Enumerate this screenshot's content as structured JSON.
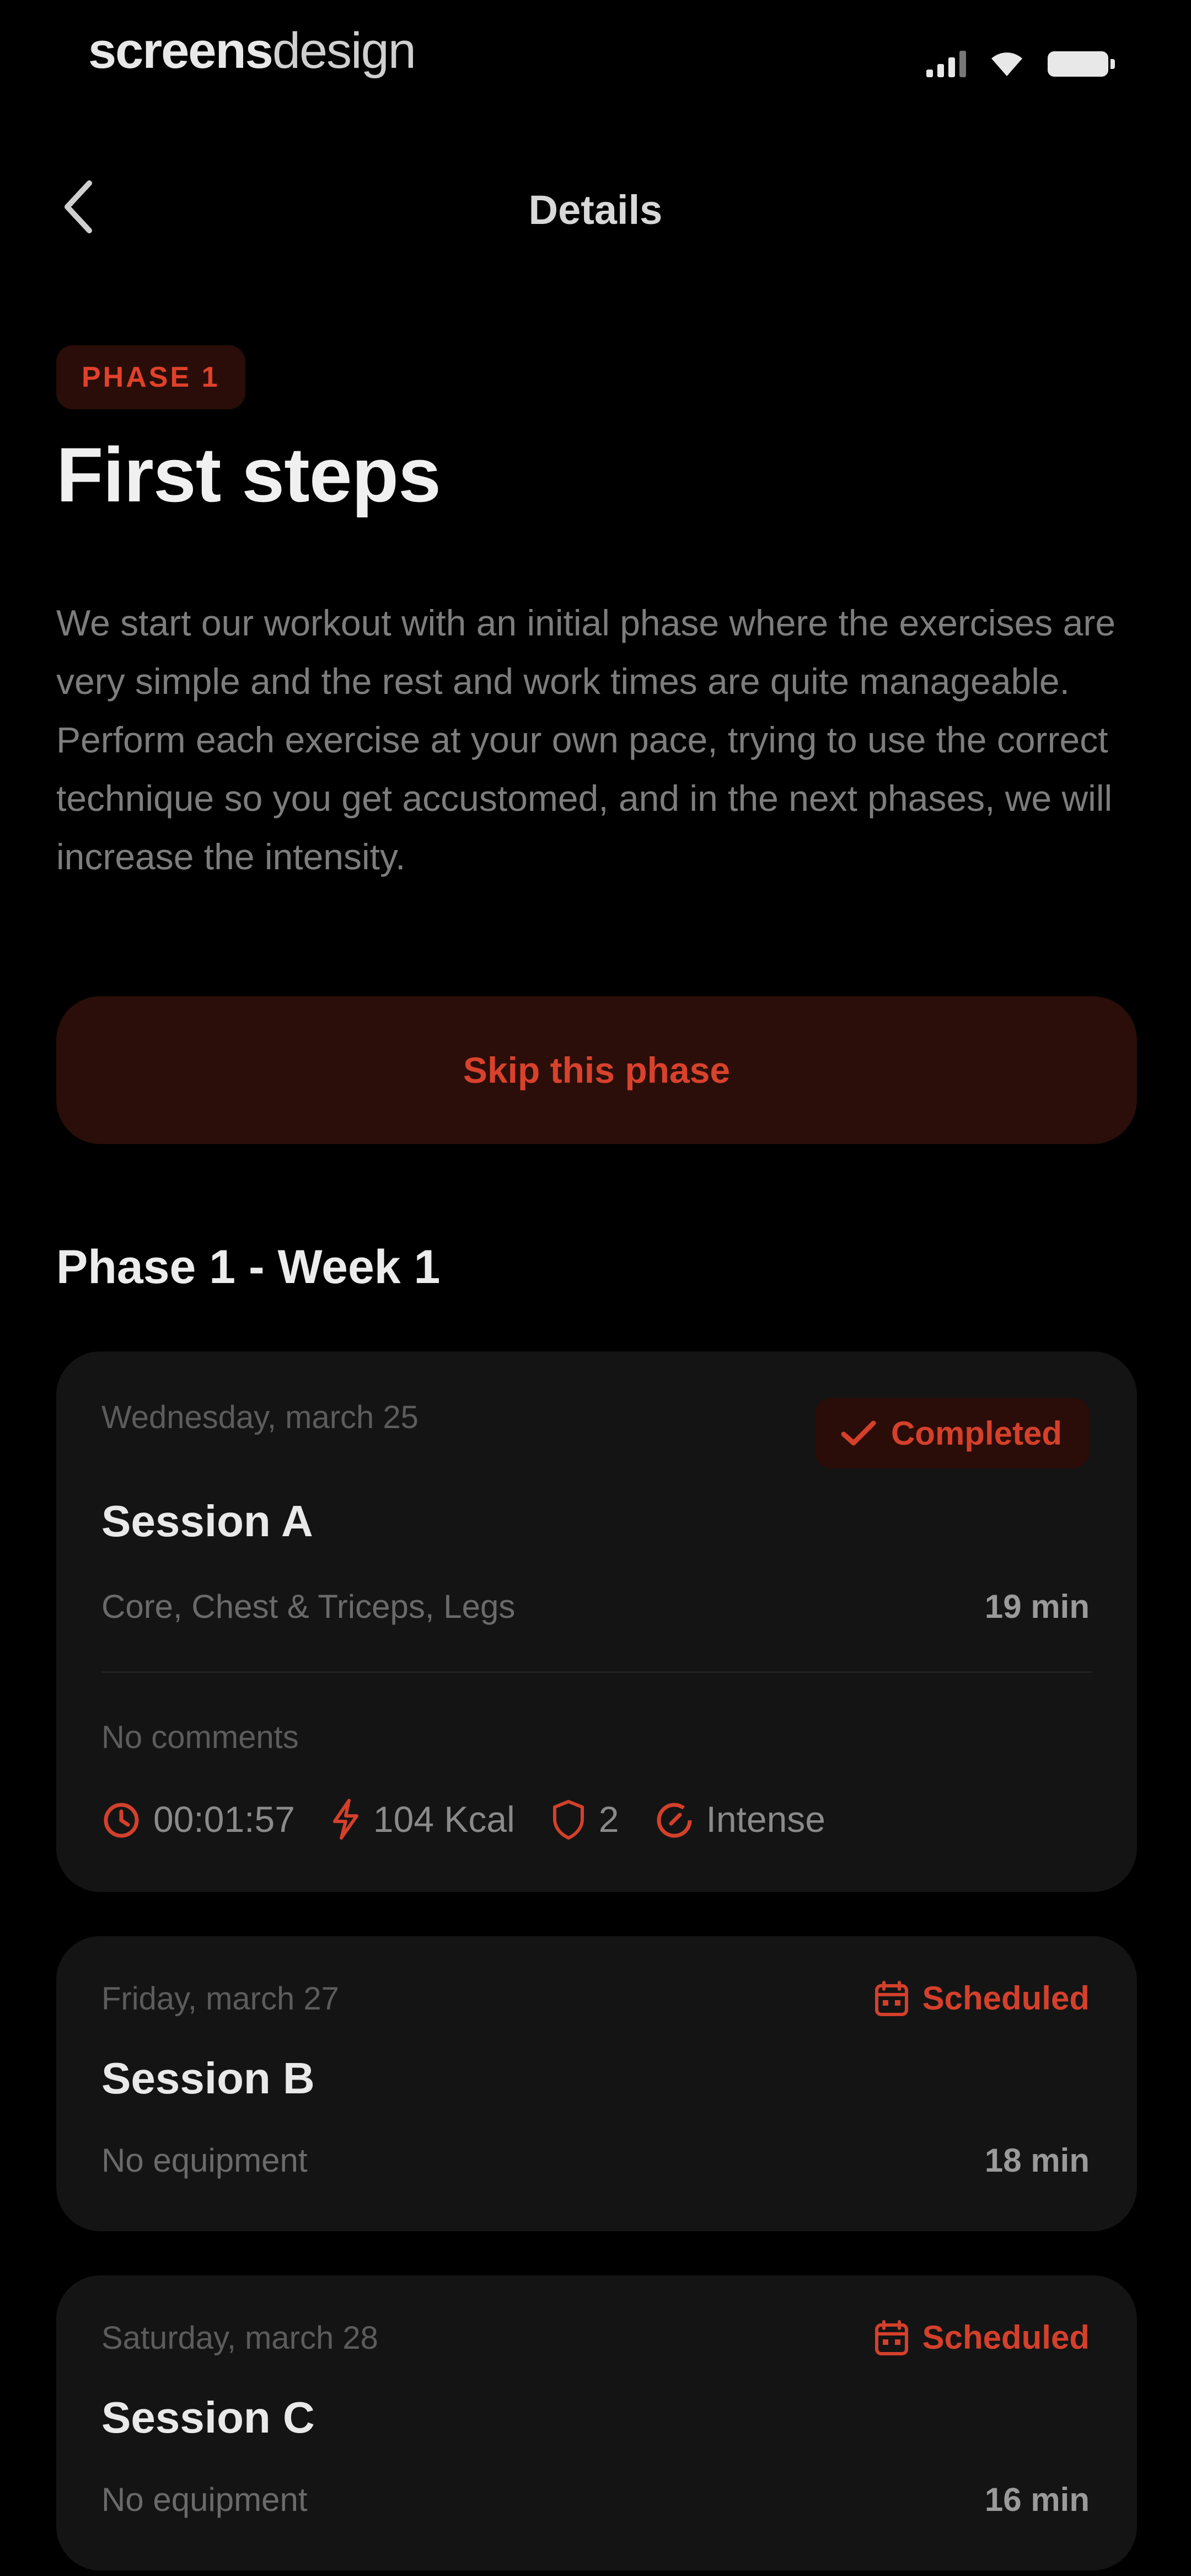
{
  "status_bar": {
    "brand_bold": "screens",
    "brand_light": "design"
  },
  "nav": {
    "title": "Details"
  },
  "phase": {
    "badge": "PHASE 1",
    "title": "First steps",
    "description": "We start our workout with an initial phase where the exercises are very simple and the rest and work times are quite manageable. Perform each exercise at your own pace, trying to use the correct technique so you get accustomed, and in the next phases, we will increase the intensity.",
    "skip_label": "Skip this phase"
  },
  "week": {
    "title": "Phase 1 - Week 1"
  },
  "sessions": [
    {
      "date": "Wednesday, march 25",
      "status": "Completed",
      "name": "Session A",
      "subtitle": "Core, Chest & Triceps, Legs",
      "duration": "19 min",
      "comments": "No comments",
      "time": "00:01:57",
      "kcal": "104 Kcal",
      "count": "2",
      "intensity": "Intense"
    },
    {
      "date": "Friday, march 27",
      "status": "Scheduled",
      "name": "Session B",
      "subtitle": "No equipment",
      "duration": "18 min"
    },
    {
      "date": "Saturday, march 28",
      "status": "Scheduled",
      "name": "Session C",
      "subtitle": "No equipment",
      "duration": "16 min"
    }
  ],
  "colors": {
    "accent": "#d4402b",
    "background": "#000000",
    "card": "#141414"
  }
}
